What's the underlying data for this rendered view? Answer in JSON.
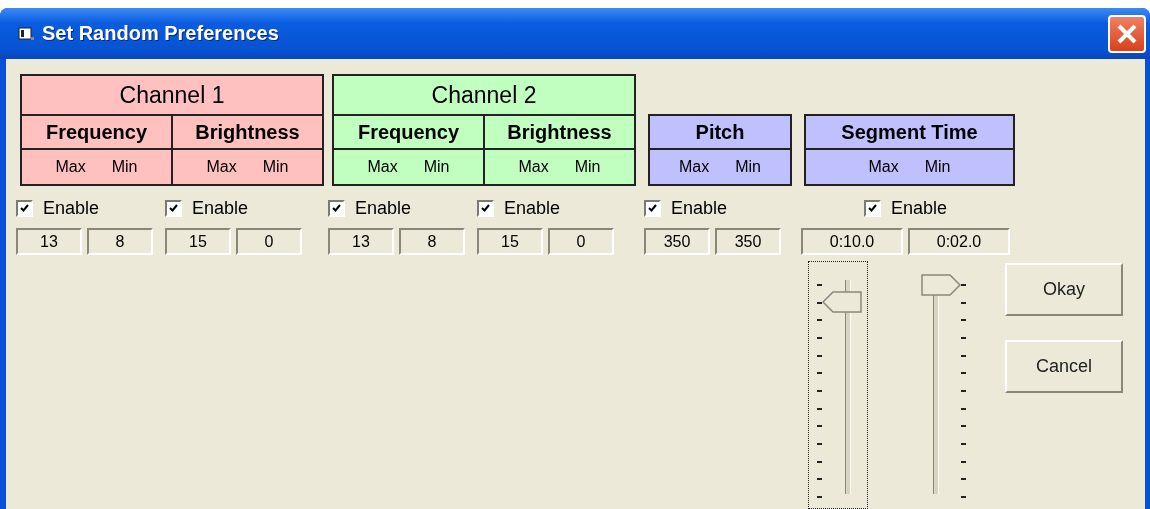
{
  "window": {
    "title": "Set Random Preferences"
  },
  "sections": [
    {
      "title": "Channel 1",
      "color": "#ffc0c0",
      "params": [
        {
          "name": "Frequency",
          "max_label": "Max",
          "min_label": "Min",
          "enable": {
            "label": "Enable",
            "checked": true
          },
          "max": "13",
          "min": "8"
        },
        {
          "name": "Brightness",
          "max_label": "Max",
          "min_label": "Min",
          "enable": {
            "label": "Enable",
            "checked": true
          },
          "max": "15",
          "min": "0"
        }
      ]
    },
    {
      "title": "Channel 2",
      "color": "#c0ffc0",
      "params": [
        {
          "name": "Frequency",
          "max_label": "Max",
          "min_label": "Min",
          "enable": {
            "label": "Enable",
            "checked": true
          },
          "max": "13",
          "min": "8"
        },
        {
          "name": "Brightness",
          "max_label": "Max",
          "min_label": "Min",
          "enable": {
            "label": "Enable",
            "checked": true
          },
          "max": "15",
          "min": "0"
        }
      ]
    },
    {
      "color": "#c0c0ff",
      "params": [
        {
          "name": "Pitch",
          "max_label": "Max",
          "min_label": "Min",
          "enable": {
            "label": "Enable",
            "checked": true
          },
          "max": "350",
          "min": "350"
        }
      ]
    },
    {
      "color": "#c0c0ff",
      "params": [
        {
          "name": "Segment Time",
          "max_label": "Max",
          "min_label": "Min",
          "enable": {
            "label": "Enable",
            "checked": true
          },
          "max": "0:10.0",
          "min": "0:02.0",
          "sliders": [
            {
              "kind": "ticks-left",
              "focused": true,
              "level": 0.92
            },
            {
              "kind": "ticks-right",
              "focused": false,
              "level": 1
            }
          ]
        }
      ]
    }
  ],
  "buttons": [
    "Okay",
    "Cancel"
  ]
}
